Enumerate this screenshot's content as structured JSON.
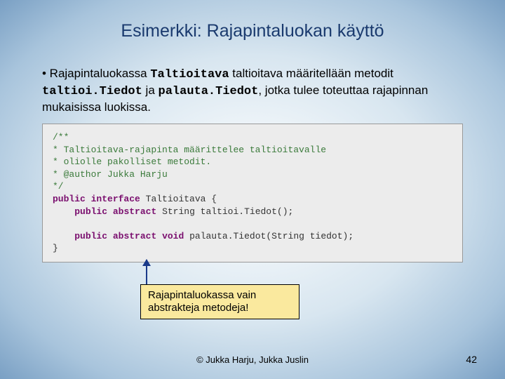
{
  "title": "Esimerkki: Rajapintaluokan käyttö",
  "bullet": {
    "pre": "• Rajapintaluokassa ",
    "c1": "Taltioitava",
    "mid1": " taltioitava määritellään metodit ",
    "c2": "taltioi.Tiedot",
    "mid2": " ja ",
    "c3": "palauta.Tiedot",
    "post": ", jotka tulee toteuttaa rajapinnan mukaisissa luokissa."
  },
  "code": {
    "l1": "/**",
    "l2": " * Taltioitava-rajapinta määrittelee taltioitavalle",
    "l3": " * oliolle pakolliset metodit.",
    "l4": " * @author Jukka Harju",
    "l5": " */",
    "kw_pub": "public",
    "kw_int": "interface",
    "iface": " Taltioitava {",
    "kw_abs": "abstract",
    "ret1": " String taltioi.Tiedot();",
    "kw_void": "void",
    "ret2": " palauta.Tiedot(String tiedot);",
    "close": "}"
  },
  "callout": {
    "l1": "Rajapintaluokassa vain",
    "l2": "abstrakteja metodeja!"
  },
  "footer": "© Jukka Harju, Jukka Juslin",
  "page": "42"
}
